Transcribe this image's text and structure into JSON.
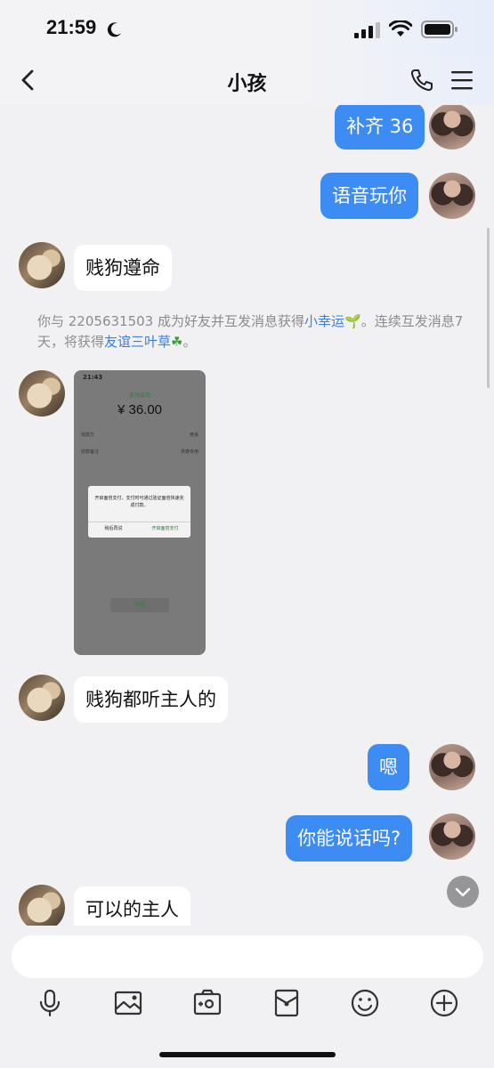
{
  "status_bar": {
    "time": "21:59"
  },
  "header": {
    "title": "小孩"
  },
  "messages": [
    {
      "sender": "me",
      "text": "补齐 36"
    },
    {
      "sender": "me",
      "text": "语音玩你"
    },
    {
      "sender": "them",
      "text": "贱狗遵命"
    },
    {
      "sender": "them",
      "text": "贱狗都听主人的"
    },
    {
      "sender": "me",
      "text": "嗯"
    },
    {
      "sender": "me",
      "text": "你能说话吗?"
    },
    {
      "sender": "them",
      "text": "可以的主人"
    }
  ],
  "system_notice": {
    "prefix": "你与 2205631503 成为好友并互发消息获得",
    "link1": "小幸运",
    "middle": "。连续互发消息7天，将获得",
    "link2": "友谊三叶草",
    "suffix": "。"
  },
  "payment_screenshot": {
    "time": "21:43",
    "status": "支付成功",
    "amount": "¥ 36.00",
    "row1_label": "收款方",
    "row1_value": "黄良",
    "row2_label": "收款备注",
    "row2_value": "供春专用",
    "dialog_text": "开启面容支付，支付时可通过验证面容快速完成付款。",
    "dialog_left": "稍后再说",
    "dialog_right": "开启面容支付",
    "done_label": "完成"
  },
  "composer": {
    "input_value": ""
  },
  "toolbar": {
    "icons": [
      "microphone-icon",
      "image-icon",
      "camera-icon",
      "red-packet-icon",
      "emoji-icon",
      "plus-icon"
    ]
  },
  "colors": {
    "accent": "#3d8cf3",
    "background": "#f1f1f3",
    "link": "#3d7fdb"
  }
}
